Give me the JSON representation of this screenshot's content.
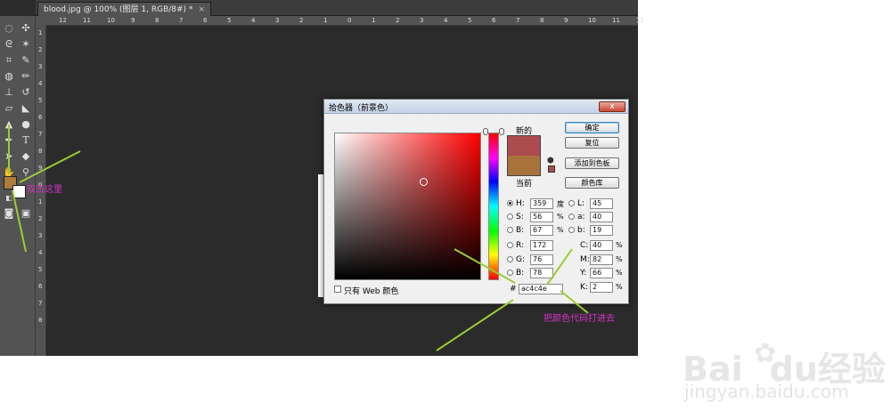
{
  "document_tab": {
    "title": "blood.jpg @ 100% (图层 1, RGB/8#) *",
    "close_glyph": "×"
  },
  "ruler": {
    "top_ticks": [
      "12",
      "11",
      "10",
      "9",
      "8",
      "7",
      "6",
      "5",
      "4",
      "3",
      "2",
      "1",
      "0",
      "1",
      "2",
      "3",
      "4",
      "5",
      "6",
      "7",
      "8",
      "9",
      "10",
      "11",
      "12"
    ],
    "left_ticks": [
      "1",
      "2",
      "3",
      "4",
      "5",
      "6",
      "7",
      "8",
      "9",
      "0",
      "1",
      "2",
      "3",
      "4",
      "5",
      "6",
      "7",
      "8"
    ]
  },
  "tools": [
    "marquee-icon",
    "move-icon",
    "lasso-icon",
    "magic-wand-icon",
    "crop-icon",
    "eyedropper-icon",
    "heal-brush-icon",
    "brush-icon",
    "stamp-icon",
    "history-brush-icon",
    "eraser-icon",
    "paint-bucket-icon",
    "blur-icon",
    "dodge-icon",
    "pen-icon",
    "type-icon",
    "path-select-icon",
    "shape-icon",
    "hand-icon",
    "zoom-icon"
  ],
  "type_tool_glyph": "T",
  "colors": {
    "foreground": "#ac7c3c",
    "background": "#ffffff",
    "new": "#ac4c4e",
    "current": "#a7733a",
    "accent_anno": "#d633c7",
    "arrow": "#9acd32"
  },
  "dialog": {
    "title": "拾色器（前景色）",
    "close_glyph": "x",
    "new_label": "新的",
    "current_label": "当前",
    "buttons": {
      "ok": "确定",
      "reset": "复位",
      "add_swatch": "添加到色板",
      "libraries": "颜色库"
    },
    "hsb": [
      {
        "label": "H:",
        "value": "359",
        "unit": "度",
        "selected": true
      },
      {
        "label": "S:",
        "value": "56",
        "unit": "%",
        "selected": false
      },
      {
        "label": "B:",
        "value": "67",
        "unit": "%",
        "selected": false
      }
    ],
    "rgb": [
      {
        "label": "R:",
        "value": "172"
      },
      {
        "label": "G:",
        "value": "76"
      },
      {
        "label": "B:",
        "value": "78"
      }
    ],
    "lab": [
      {
        "label": "L:",
        "value": "45"
      },
      {
        "label": "a:",
        "value": "40"
      },
      {
        "label": "b:",
        "value": "19"
      }
    ],
    "cmyk": [
      {
        "label": "C:",
        "value": "40",
        "unit": "%"
      },
      {
        "label": "M:",
        "value": "82",
        "unit": "%"
      },
      {
        "label": "Y:",
        "value": "66",
        "unit": "%"
      },
      {
        "label": "K:",
        "value": "2",
        "unit": "%"
      }
    ],
    "web_only_label": "只有 Web 颜色",
    "hex_prefix": "#",
    "hex_value": "ac4c4e"
  },
  "annotations": {
    "double_click": "双击这里",
    "type_code": "把颜色代码打进去"
  },
  "watermark": {
    "logo": "Bai",
    "logo2": "du",
    "cn": "经验",
    "url": "jingyan.baidu.com"
  }
}
